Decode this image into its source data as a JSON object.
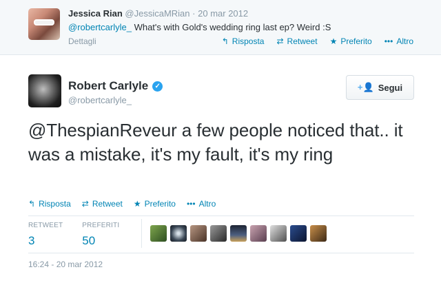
{
  "reply_tweet": {
    "name": "Jessica Rian",
    "handle": "@JessicaMRian",
    "separator": "·",
    "date": "20 mar 2012",
    "mention": "@robertcarlyle_",
    "text": " What's with Gold's wedding ring last ep? Weird :S",
    "details_label": "Dettagli",
    "actions": {
      "reply": "Risposta",
      "retweet": "Retweet",
      "favorite": "Preferito",
      "more": "Altro"
    }
  },
  "main_tweet": {
    "name": "Robert Carlyle",
    "handle": "@robertcarlyle_",
    "verified": true,
    "follow_label": "Segui",
    "text": "@ThespianReveur a few people noticed that..  it was a mistake, it's my fault, it's my ring",
    "actions": {
      "reply": "Risposta",
      "retweet": "Retweet",
      "favorite": "Preferito",
      "more": "Altro"
    },
    "stats": {
      "retweet_label": "RETWEET",
      "retweet_count": "3",
      "favorites_label": "PREFERITI",
      "favorites_count": "50"
    },
    "favoriter_avatar_count": 9,
    "timestamp": "16:24 - 20 mar 2012"
  },
  "icons": {
    "reply": "↰",
    "retweet": "⇄",
    "favorite": "★",
    "more": "•••",
    "follow": "+👤",
    "verified": "✓"
  },
  "colors": {
    "link": "#0084b4",
    "muted": "#8899a6",
    "text": "#292f33",
    "verified": "#2aa3ef",
    "reply_bg": "#f5f8fa"
  }
}
